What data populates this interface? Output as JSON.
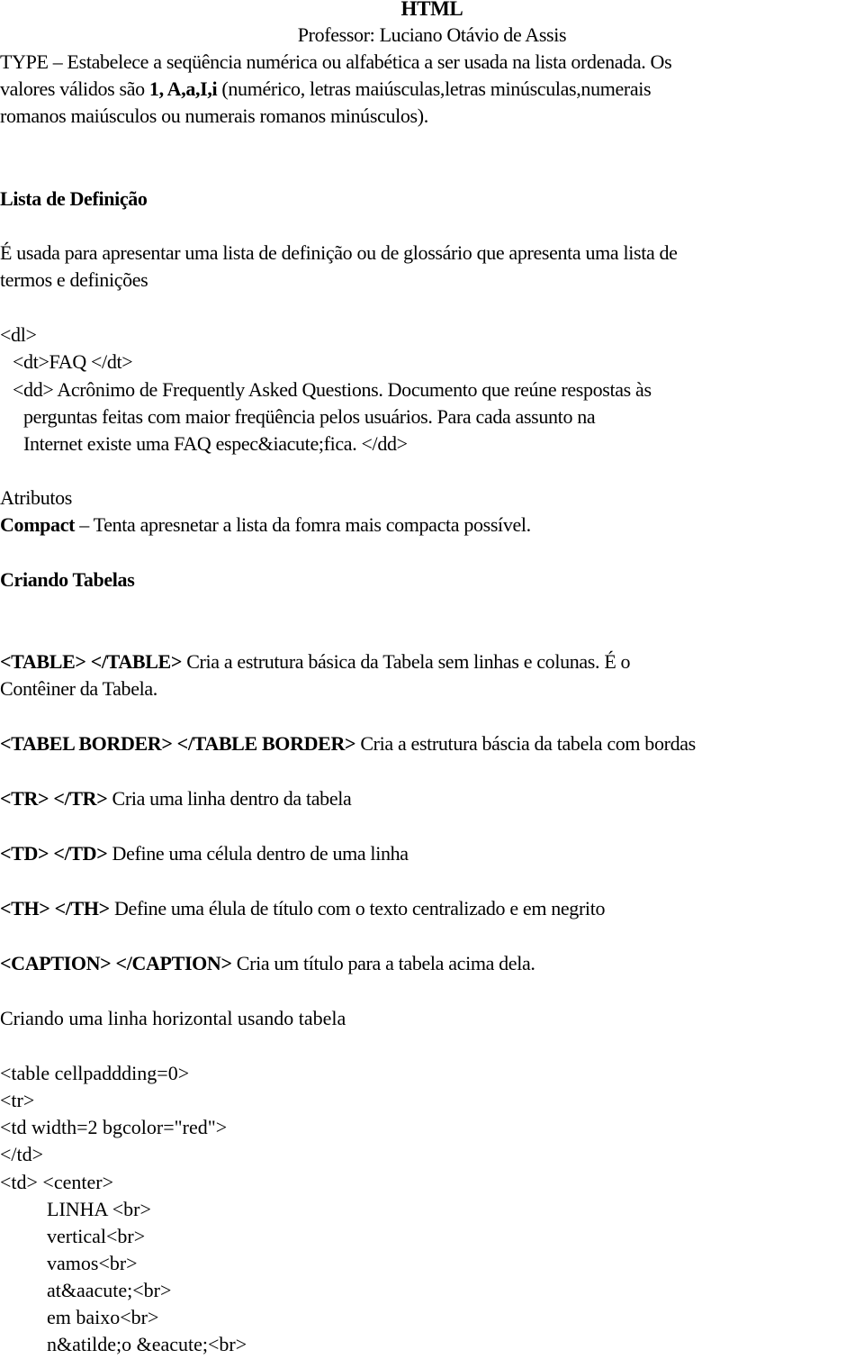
{
  "header": {
    "title": "HTML",
    "subtitle": "Professor: Luciano Otávio de Assis"
  },
  "intro": {
    "line1": "TYPE – Estabelece a seqüência numérica ou alfabética a ser usada na lista ordenada. Os",
    "line2_pre": "valores válidos são ",
    "line2_bold": "1, A,a,I,i",
    "line2_post": " (numérico, letras maiúsculas,letras minúsculas,numerais",
    "line3": "romanos maiúsculos ou numerais romanos minúsculos)."
  },
  "definition_list_section": {
    "heading": "Lista de Definição",
    "desc_line1": "É usada para apresentar uma lista de definição ou de glossário que apresenta uma lista de",
    "desc_line2": "termos e definições",
    "code": {
      "dl": "<dl>",
      "dt": "<dt>FAQ </dt>",
      "dd_line1": "<dd> Acrônimo de Frequently Asked Questions. Documento que reúne respostas às",
      "dd_line2": "perguntas feitas com maior freqüência pelos usuários. Para cada assunto na",
      "dd_line3": "Internet existe uma FAQ espec&iacute;fica. </dd>"
    },
    "attributes_label": "Atributos",
    "attribute": {
      "name": "Compact",
      "description": " – Tenta apresnetar a lista da fomra mais compacta possível."
    }
  },
  "tables_section": {
    "heading": "Criando Tabelas",
    "items": [
      {
        "tag": "<TABLE> </TABLE>",
        "text": " Cria a estrutura básica da Tabela sem linhas e colunas. É o",
        "text2": "Contêiner da Tabela."
      },
      {
        "tag": "<TABEL BORDER> </TABLE BORDER>",
        "text": " Cria a estrutura báscia da tabela com bordas"
      },
      {
        "tag": "<TR> </TR>",
        "text": " Cria uma linha dentro da tabela"
      },
      {
        "tag": "<TD> </TD>",
        "text": " Define uma célula dentro de uma linha"
      },
      {
        "tag": "<TH> </TH>",
        "text": " Define uma élula de título com o texto centralizado e em negrito"
      },
      {
        "tag": "<CAPTION> </CAPTION>",
        "text": " Cria um título para a tabela acima dela."
      }
    ]
  },
  "horizontal_line_section": {
    "heading": "Criando uma linha horizontal usando tabela",
    "code_lines": [
      "<table cellpaddding=0>",
      "<tr>",
      "<td width=2 bgcolor=\"red\">",
      "</td>",
      "<td> <center>"
    ],
    "indented_lines": [
      "LINHA <br>",
      "vertical<br>",
      "vamos<br>",
      "at&aacute;<br>",
      "em baixo<br>",
      "n&atilde;o &eacute;<br>"
    ]
  }
}
